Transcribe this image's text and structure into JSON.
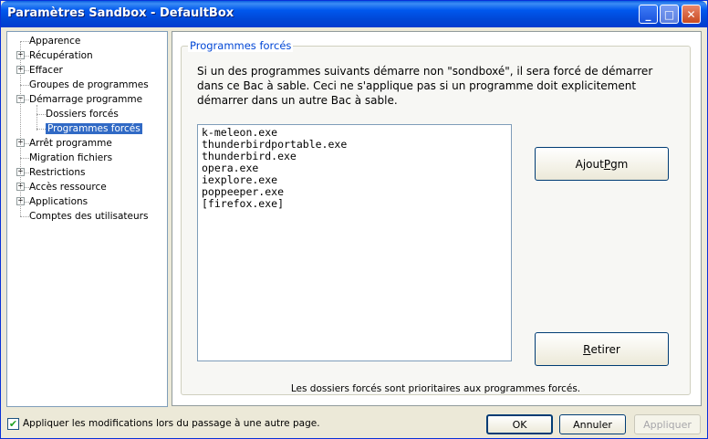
{
  "window": {
    "title": "Paramètres Sandbox - DefaultBox",
    "minimize_glyph": "_",
    "maximize_glyph": "□",
    "close_glyph": "✕"
  },
  "tree": {
    "items": [
      {
        "label": "Apparence",
        "expander": ""
      },
      {
        "label": "Récupération",
        "expander": "+"
      },
      {
        "label": "Effacer",
        "expander": "+"
      },
      {
        "label": "Groupes de programmes",
        "expander": ""
      },
      {
        "label": "Démarrage programme",
        "expander": "−"
      },
      {
        "label": "Dossiers forcés",
        "expander": ""
      },
      {
        "label": "Programmes forcés",
        "expander": "",
        "selected": true
      },
      {
        "label": "Arrêt programme",
        "expander": "+"
      },
      {
        "label": "Migration fichiers",
        "expander": ""
      },
      {
        "label": "Restrictions",
        "expander": "+"
      },
      {
        "label": "Accès ressource",
        "expander": "+"
      },
      {
        "label": "Applications",
        "expander": "+"
      },
      {
        "label": "Comptes des utilisateurs",
        "expander": ""
      }
    ]
  },
  "panel": {
    "group_title": "Programmes forcés",
    "description": "Si un des programmes suivants démarre non \"sondboxé\", il sera forcé de démarrer dans ce Bac à sable. Ceci ne s'applique pas si un programme doit explicitement démarrer dans un autre Bac à sable.",
    "programs": [
      "k-meleon.exe",
      "thunderbirdportable.exe",
      "thunderbird.exe",
      "opera.exe",
      "iexplore.exe",
      "poppeeper.exe",
      "[firefox.exe]"
    ],
    "add_button": "Ajout Pgm",
    "remove_button": "Retirer",
    "footnote": "Les dossiers forcés sont prioritaires aux programmes forcés."
  },
  "footer": {
    "apply_checkbox_label": "Appliquer les modifications lors du passage à une autre page.",
    "apply_checked": true,
    "check_glyph": "✔",
    "ok_button": "OK",
    "cancel_button": "Annuler",
    "apply_button": "Appliquer"
  }
}
